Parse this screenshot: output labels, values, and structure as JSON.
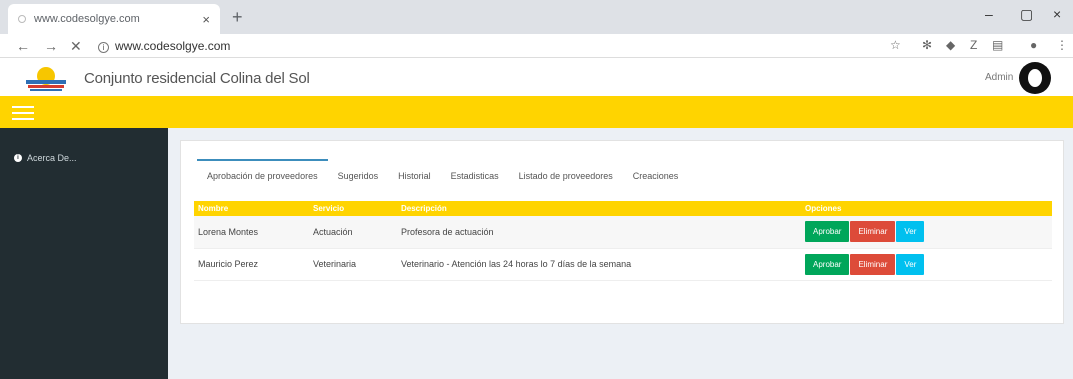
{
  "browser": {
    "tab_title": "www.codesolgye.com",
    "tab_close": "×",
    "new_tab": "+",
    "url": "www.codesolgye.com",
    "minimize": "–",
    "maximize": "▢",
    "close": "×"
  },
  "header": {
    "site_name": "Conjunto residencial Colina del Sol",
    "user": "Admin"
  },
  "sidebar": {
    "items": [
      {
        "label": "Acerca De..."
      }
    ]
  },
  "tabs": [
    {
      "label": "Aprobación de proveedores"
    },
    {
      "label": "Sugeridos"
    },
    {
      "label": "Historial"
    },
    {
      "label": "Estadisticas"
    },
    {
      "label": "Listado de proveedores"
    },
    {
      "label": "Creaciones"
    }
  ],
  "table": {
    "headers": [
      "Nombre",
      "Servicio",
      "Descripción",
      "Opciones"
    ],
    "rows": [
      {
        "name": "Lorena Montes",
        "service": "Actuación",
        "description": "Profesora de actuación"
      },
      {
        "name": "Mauricio Perez",
        "service": "Veterinaria",
        "description": "Veterinario - Atención las 24 horas lo 7 días de la semana"
      }
    ],
    "actions": {
      "approve": "Aprobar",
      "delete": "Eliminar",
      "view": "Ver"
    }
  },
  "colors": {
    "accent": "#ffd400",
    "sidebar": "#222d32",
    "approve": "#00a65a",
    "delete": "#dd4b39",
    "view": "#00c0ef"
  }
}
